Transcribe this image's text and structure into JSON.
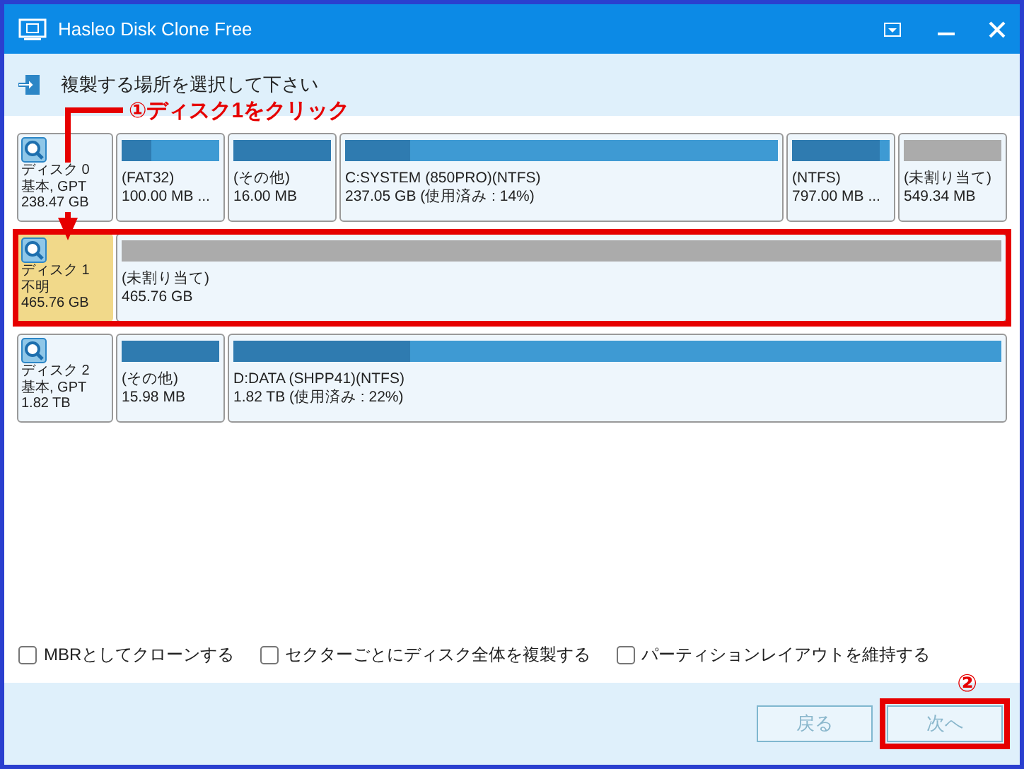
{
  "window": {
    "title": "Hasleo Disk Clone Free"
  },
  "header": {
    "instruction": "複製する場所を選択して下さい"
  },
  "disks": [
    {
      "name": "ディスク 0",
      "type": "基本, GPT",
      "size": "238.47 GB",
      "selected": false,
      "partitions": [
        {
          "kind": "partition",
          "label": "(FAT32)",
          "size": "100.00 MB ...",
          "level": 0.3
        },
        {
          "kind": "partition",
          "label": "(その他)",
          "size": "16.00 MB",
          "level": 1
        },
        {
          "kind": "partition",
          "label": "C:SYSTEM (850PRO)(NTFS)",
          "size": "237.05 GB (使用済み : 14%)",
          "level": 0.15
        },
        {
          "kind": "partition",
          "label": "(NTFS)",
          "size": "797.00 MB ...",
          "level": 0.9
        },
        {
          "kind": "unallocated",
          "label": "(未割り当て)",
          "size": "549.34 MB"
        }
      ]
    },
    {
      "name": "ディスク 1",
      "type": "不明",
      "size": "465.76 GB",
      "selected": true,
      "partitions": [
        {
          "kind": "unallocated",
          "label": "(未割り当て)",
          "size": "465.76 GB"
        }
      ]
    },
    {
      "name": "ディスク 2",
      "type": "基本, GPT",
      "size": "1.82 TB",
      "selected": false,
      "partitions": [
        {
          "kind": "partition",
          "label": "(その他)",
          "size": "15.98 MB",
          "level": 1
        },
        {
          "kind": "partition",
          "label": "D:DATA (SHPP41)(NTFS)",
          "size": "1.82 TB (使用済み : 22%)",
          "level": 0.23
        }
      ]
    }
  ],
  "options": [
    {
      "label": "MBRとしてクローンする",
      "checked": false
    },
    {
      "label": "セクターごとにディスク全体を複製する",
      "checked": false
    },
    {
      "label": "パーティションレイアウトを維持する",
      "checked": false
    }
  ],
  "buttons": [
    {
      "label": "戻る",
      "disabled": true
    },
    {
      "label": "次へ",
      "disabled": true
    }
  ],
  "annotations": [
    {
      "kind": "step-callout",
      "text": "①ディスク1をクリック"
    },
    {
      "kind": "step-number",
      "text": "②"
    }
  ]
}
